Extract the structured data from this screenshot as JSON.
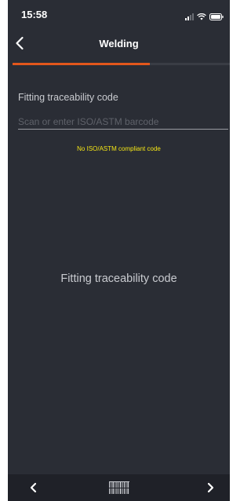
{
  "status_bar": {
    "time": "15:58",
    "icons": [
      "signal-icon",
      "wifi-icon",
      "battery-icon"
    ]
  },
  "header": {
    "title": "Welding",
    "back_icon": "chevron-left-icon"
  },
  "progress": {
    "value": 0.63,
    "color": "#e2571c"
  },
  "form": {
    "label": "Fitting traceability code",
    "input_value": "",
    "input_placeholder": "Scan or enter ISO/ASTM barcode",
    "warning": "No ISO/ASTM compliant code",
    "warning_color": "#f5e616"
  },
  "main": {
    "center_label": "Fitting traceability code"
  },
  "bottom_bar": {
    "prev_icon": "chevron-left-icon",
    "scan_icon": "barcode-icon",
    "next_icon": "chevron-right-icon"
  },
  "colors": {
    "background": "#2a2d35",
    "accent": "#e2571c"
  }
}
